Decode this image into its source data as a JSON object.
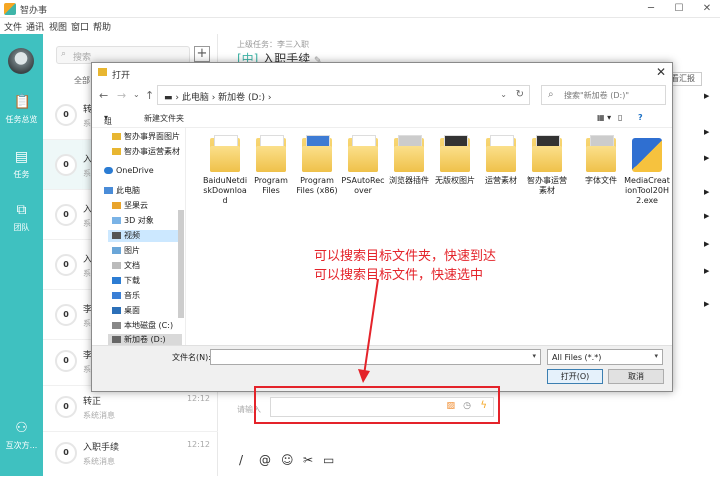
{
  "app": {
    "title": "智办事",
    "window_controls": [
      "minimize-icon",
      "maximize-icon",
      "close-icon"
    ]
  },
  "menu": [
    "文件",
    "通讯",
    "视图",
    "窗口",
    "帮助"
  ],
  "sidebar": {
    "items": [
      {
        "label": "任务总览",
        "icon": "clipboard-icon"
      },
      {
        "label": "任务",
        "icon": "document-icon"
      },
      {
        "label": "团队",
        "icon": "org-chart-icon"
      },
      {
        "label": "互次方...",
        "icon": "people-icon"
      }
    ]
  },
  "search": {
    "placeholder": "搜索"
  },
  "list_partial": {
    "all_label": "全部"
  },
  "task_list": [
    {
      "count": "0",
      "name": "转",
      "sub": "系",
      "time": ""
    },
    {
      "count": "0",
      "name": "入",
      "sub": "系",
      "time": ""
    },
    {
      "count": "0",
      "name": "入",
      "sub": "系",
      "time": ""
    },
    {
      "count": "0",
      "name": "入",
      "sub": "系",
      "time": ""
    },
    {
      "count": "0",
      "name": "李",
      "sub": "系",
      "time": ""
    },
    {
      "count": "0",
      "name": "李",
      "sub": "系",
      "time": ""
    },
    {
      "count": "0",
      "name": "转正",
      "sub": "系统消息",
      "time": "12:12"
    },
    {
      "count": "0",
      "name": "入职手续",
      "sub": "系统消息",
      "time": "12:12"
    }
  ],
  "content": {
    "breadcrumb": "上级任务：李三入职",
    "tag": "[中]",
    "title": "入职手续",
    "report_button": "查看汇报",
    "input_hint": "请输入",
    "toolbar_icons": [
      "slash-icon",
      "at-icon",
      "emoji-icon",
      "scissors-icon",
      "folder-icon"
    ]
  },
  "dialog": {
    "title": "打开",
    "path": [
      "此电脑",
      "新加卷 (D:)"
    ],
    "search_placeholder": "搜索\"新加卷 (D:)\"",
    "toolbar": {
      "organize": "组织",
      "new_folder": "新建文件夹"
    },
    "tree": [
      {
        "label": "智办事界面图片",
        "icon": "folder"
      },
      {
        "label": "智办事运营素材",
        "icon": "folder"
      },
      {
        "label": "OneDrive",
        "icon": "cloud"
      },
      {
        "label": "此电脑",
        "icon": "pc"
      },
      {
        "label": "坚果云",
        "icon": "folder"
      },
      {
        "label": "3D 对象",
        "icon": "cube"
      },
      {
        "label": "视频",
        "icon": "video"
      },
      {
        "label": "图片",
        "icon": "image"
      },
      {
        "label": "文档",
        "icon": "doc"
      },
      {
        "label": "下载",
        "icon": "download"
      },
      {
        "label": "音乐",
        "icon": "music"
      },
      {
        "label": "桌面",
        "icon": "desktop"
      },
      {
        "label": "本地磁盘 (C:)",
        "icon": "drive"
      },
      {
        "label": "新加卷 (D:)",
        "icon": "drive"
      }
    ],
    "files": [
      {
        "name": "BaiduNetdiskDownload",
        "kind": "folder"
      },
      {
        "name": "Program Files",
        "kind": "folder"
      },
      {
        "name": "Program Files (x86)",
        "kind": "folder-blue"
      },
      {
        "name": "PSAutoRecover",
        "kind": "folder"
      },
      {
        "name": "浏览器插件",
        "kind": "folder-gray"
      },
      {
        "name": "无版权图片",
        "kind": "folder-dark"
      },
      {
        "name": "运营素材",
        "kind": "folder"
      },
      {
        "name": "智办事运营素材",
        "kind": "folder-dark"
      },
      {
        "name": "字体文件",
        "kind": "folder-gray"
      },
      {
        "name": "MediaCreationTool20H2.exe",
        "kind": "exe"
      }
    ],
    "filename_label": "文件名(N):",
    "filename_value": "",
    "filetype": "All Files (*.*)",
    "open_button": "打开(O)",
    "cancel_button": "取消"
  },
  "annotations": {
    "line1": "可以搜索目标文件夹，快速到达",
    "line2": "可以搜索目标文件，快速选中",
    "color": "#e4232a"
  },
  "colors": {
    "accent": "#3fc1c0",
    "annotation": "#e4232a"
  }
}
